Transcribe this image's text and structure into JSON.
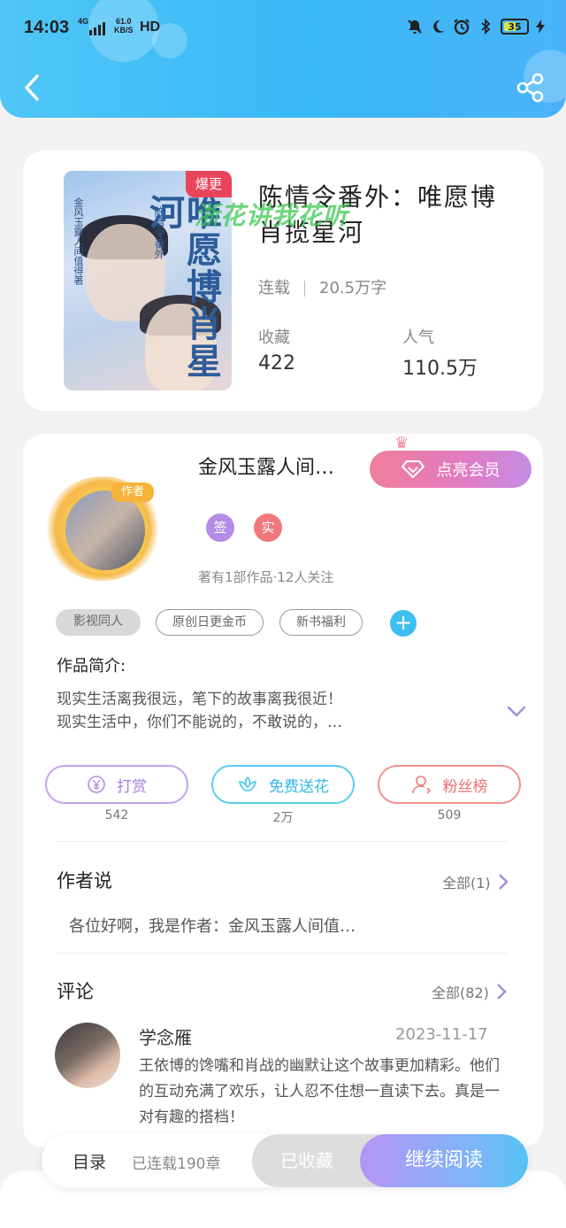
{
  "status_bar": {
    "time": "14:03",
    "network": "4G",
    "speed": "61.0",
    "speed_unit": "KB/S",
    "hd": "HD",
    "battery": "35"
  },
  "book": {
    "cover_title": "唯愿博肖星河",
    "cover_subtitle": "陈情令番外",
    "cover_author": "金风玉露人间值得著",
    "hot_badge": "爆更",
    "title": "陈情令番外：唯愿博肖揽星河",
    "watermark": "浙花讲我花听",
    "status": "连载",
    "word_count": "20.5万字",
    "favorites_label": "收藏",
    "favorites_value": "422",
    "popularity_label": "人气",
    "popularity_value": "110.5万"
  },
  "author": {
    "tag": "作者",
    "name": "金风玉露人间…",
    "vip_button": "点亮会员",
    "badge_sign": "签",
    "badge_real": "实",
    "info": "著有1部作品·12人关注"
  },
  "tags": [
    "影视同人",
    "原创日更金币",
    "新书福利"
  ],
  "intro": {
    "title": "作品简介:",
    "line1": "现实生活离我很远，笔下的故事离我很近！",
    "line2": "现实生活中，你们不能说的，不敢说的，…"
  },
  "actions": {
    "reward_label": "打赏",
    "reward_count": "542",
    "flower_label": "免费送花",
    "flower_count": "2万",
    "fans_label": "粉丝榜",
    "fans_count": "509"
  },
  "author_says": {
    "title": "作者说",
    "more": "全部(1)",
    "text": "各位好啊，我是作者：金风玉露人间值…"
  },
  "comments": {
    "title": "评论",
    "more": "全部(82)",
    "items": [
      {
        "name": "学念雁",
        "date": "2023-11-17",
        "text": "王依博的馋嘴和肖战的幽默让这个故事更加精彩。他们的互动充满了欢乐，让人忍不住想一直读下去。真是一对有趣的搭档！"
      }
    ]
  },
  "bottom": {
    "toc": "目录",
    "toc_count": "已连载190章",
    "collected": "已收藏",
    "continue": "继续阅读"
  },
  "colors": {
    "header": "#3ab9f6",
    "reward": "#b58de6",
    "flower": "#3ec6ee",
    "fans": "#f07c7c",
    "vip": "#e87ca5"
  }
}
